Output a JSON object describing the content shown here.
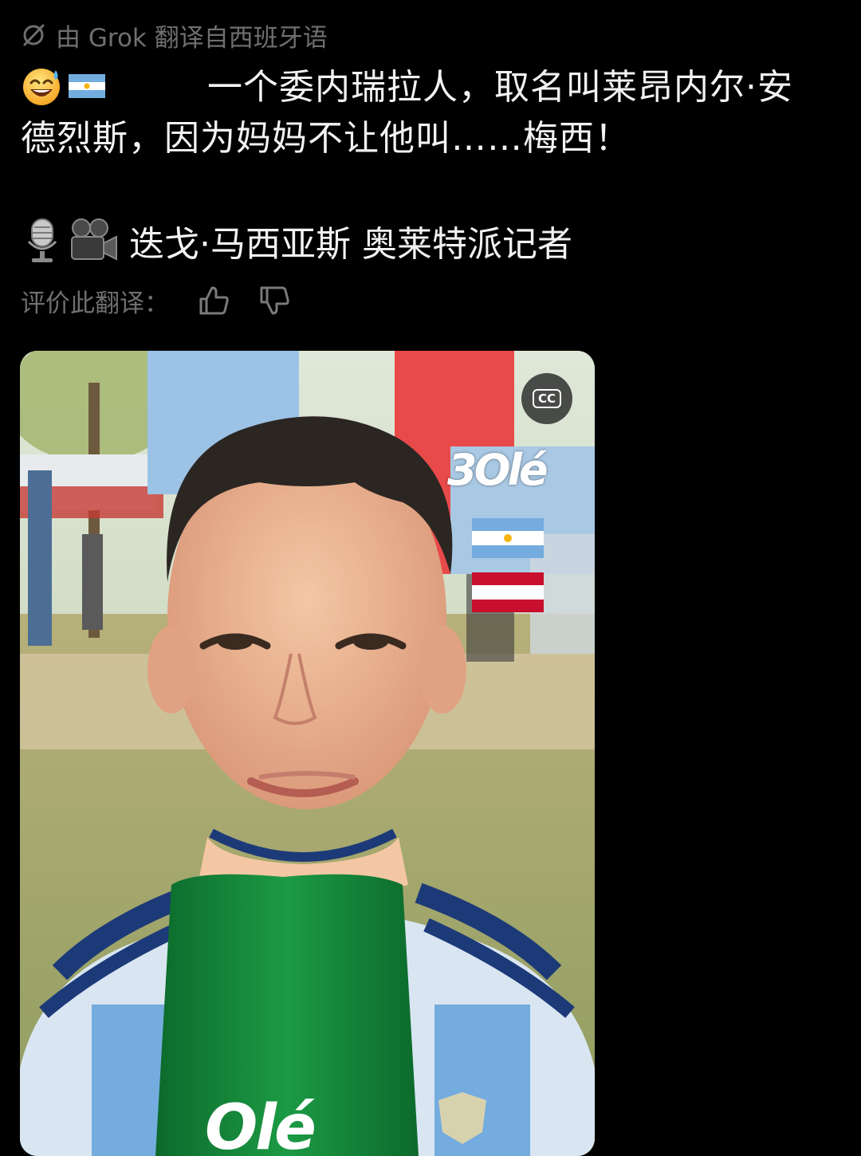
{
  "header": {
    "translated_by": "由 Grok 翻译自西班牙语",
    "icon": "grok-icon"
  },
  "post": {
    "line1_emojis": [
      "sweat-smile-emoji",
      "argentina-flag-emoji"
    ],
    "line1_text": "一个委内瑞拉人，取名叫莱昂内尔·安",
    "line2_text": "德烈斯，因为妈妈不让他叫……梅西！",
    "author_icons": [
      "microphone-emoji",
      "movie-camera-emoji"
    ],
    "author_text": "迭戈·马西亚斯 奥莱特派记者"
  },
  "rating": {
    "label": "评价此翻译：",
    "thumbs_up_icon": "thumbs-up-icon",
    "thumbs_down_icon": "thumbs-down-icon"
  },
  "video": {
    "cc_label": "CC",
    "brand_overlay": "3Olé",
    "mic_brand": "Olé",
    "flags": [
      "argentina-flag",
      "austria-flag"
    ]
  },
  "colors": {
    "background": "#000000",
    "primary_text": "#f2f2f2",
    "secondary_text": "#6f6f6f"
  }
}
